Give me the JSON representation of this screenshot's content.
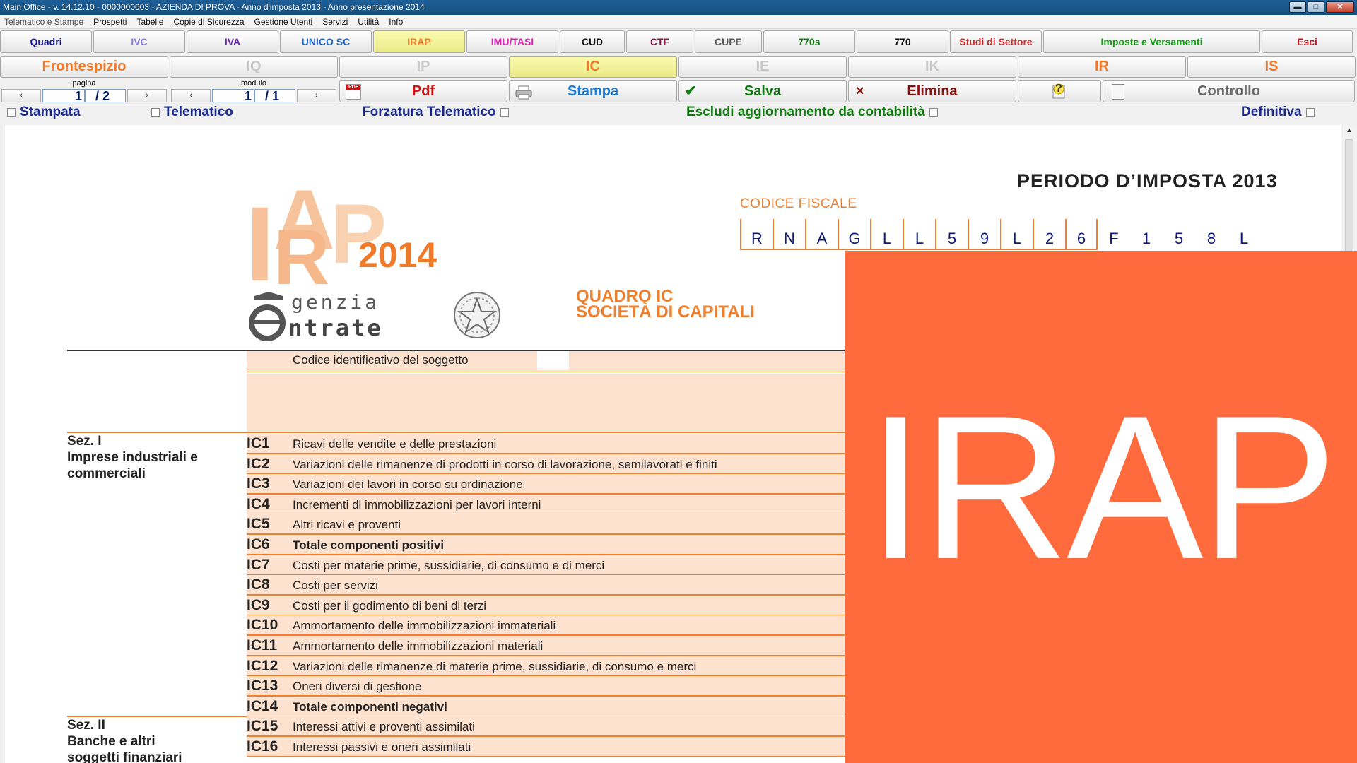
{
  "window": {
    "title": "Main Office - v. 14.12.10 - 0000000003 - AZIENDA DI PROVA - Anno d'imposta 2013 - Anno presentazione 2014",
    "minimize": "▬",
    "maximize": "□",
    "close": "✕"
  },
  "menu": [
    "Telematico e Stampe",
    "Prospetti",
    "Tabelle",
    "Copie di Sicurezza",
    "Gestione Utenti",
    "Servizi",
    "Utilità",
    "Info"
  ],
  "tabs": [
    {
      "label": "Quadri",
      "color": "#1a1aa0"
    },
    {
      "label": "IVC",
      "color": "#8a7ad8"
    },
    {
      "label": "IVA",
      "color": "#6a2ab0"
    },
    {
      "label": "UNICO SC",
      "color": "#1a6ad0"
    },
    {
      "label": "IRAP",
      "color": "#f07a2a"
    },
    {
      "label": "IMU/TASI",
      "color": "#e020b0"
    },
    {
      "label": "CUD",
      "color": "#111111"
    },
    {
      "label": "CTF",
      "color": "#8a1a4a"
    },
    {
      "label": "CUPE",
      "color": "#5a5a5a"
    },
    {
      "label": "770s",
      "color": "#107a10"
    },
    {
      "label": "770",
      "color": "#111111"
    },
    {
      "label": "Studi di Settore",
      "color": "#d02a2a"
    },
    {
      "label": "Imposte e Versamenti",
      "color": "#10a010"
    },
    {
      "label": "Esci",
      "color": "#d01010"
    }
  ],
  "quadri": [
    {
      "label": "Frontespizio",
      "color": "#f07a2a"
    },
    {
      "label": "IQ",
      "color": "#c8c8c8"
    },
    {
      "label": "IP",
      "color": "#c8c8c8"
    },
    {
      "label": "IC",
      "color": "#f07a2a"
    },
    {
      "label": "IE",
      "color": "#c8c8c8"
    },
    {
      "label": "IK",
      "color": "#c8c8c8"
    },
    {
      "label": "IR",
      "color": "#f07a2a"
    },
    {
      "label": "IS",
      "color": "#f07a2a"
    }
  ],
  "pager": {
    "pagina_label": "pagina",
    "pagina_value": "1",
    "pagina_total": "/ 2",
    "modulo_label": "modulo",
    "modulo_value": "1",
    "modulo_total": "/ 1",
    "prev": "‹",
    "next": "›"
  },
  "actions": {
    "pdf": "Pdf",
    "stampa": "Stampa",
    "salva": "Salva",
    "elimina": "Elimina",
    "controllo": "Controllo",
    "pdf_icon_text": "PDF",
    "salva_icon": "✔",
    "elimina_icon": "×",
    "help_icon": "?"
  },
  "checks": {
    "stampata": "Stampata",
    "telematico": "Telematico",
    "forzatura": "Forzatura Telematico",
    "escludi": "Escludi aggiornamento da contabilità",
    "definitiva": "Definitiva"
  },
  "form": {
    "periodo": "PERIODO D’IMPOSTA 2013",
    "codice_fiscale_label": "CODICE FISCALE",
    "codice_fiscale": [
      "R",
      "N",
      "A",
      "G",
      "L",
      "L",
      "5",
      "9",
      "L",
      "2",
      "6",
      "F",
      "1",
      "5",
      "8",
      "L"
    ],
    "logo_irap_letters": "IRAP",
    "logo_year": "2014",
    "logo_agenzia": "genzia",
    "logo_entrate": "ntrate",
    "quadro_line1": "QUADRO IC",
    "quadro_line2": "SOCIETÀ DI CAPITALI",
    "codice_identificativo": "Codice identificativo del soggetto",
    "sez1_line1": "Sez. I",
    "sez1_line2": "Imprese industriali e",
    "sez1_line3": "commerciali",
    "sez2_line1": "Sez. II",
    "sez2_line2": "Banche e altri",
    "sez2_line3": "soggetti finanziari",
    "rows": [
      {
        "code": "IC1",
        "desc": "Ricavi delle vendite e delle prestazioni",
        "bold": false
      },
      {
        "code": "IC2",
        "desc": "Variazioni delle rimanenze di prodotti in corso di lavorazione, semilavorati e finiti",
        "bold": false
      },
      {
        "code": "IC3",
        "desc": "Variazioni dei lavori in corso su ordinazione",
        "bold": false
      },
      {
        "code": "IC4",
        "desc": "Incrementi di immobilizzazioni per lavori interni",
        "bold": false
      },
      {
        "code": "IC5",
        "desc": "Altri ricavi e proventi",
        "bold": false
      },
      {
        "code": "IC6",
        "desc": "Totale componenti positivi",
        "bold": true
      },
      {
        "code": "IC7",
        "desc": "Costi per materie prime, sussidiarie, di consumo e di merci",
        "bold": false
      },
      {
        "code": "IC8",
        "desc": "Costi per servizi",
        "bold": false
      },
      {
        "code": "IC9",
        "desc": "Costi per il godimento di beni di terzi",
        "bold": false
      },
      {
        "code": "IC10",
        "desc": "Ammortamento delle immobilizzazioni immateriali",
        "bold": false
      },
      {
        "code": "IC11",
        "desc": "Ammortamento delle immobilizzazioni materiali",
        "bold": false
      },
      {
        "code": "IC12",
        "desc": "Variazioni delle rimanenze di materie prime, sussidiarie, di consumo e merci",
        "bold": false
      },
      {
        "code": "IC13",
        "desc": "Oneri diversi di gestione",
        "bold": false
      },
      {
        "code": "IC14",
        "desc": "Totale componenti negativi",
        "bold": true
      },
      {
        "code": "IC15",
        "desc": "Interessi attivi e proventi assimilati",
        "bold": false
      },
      {
        "code": "IC16",
        "desc": "Interessi passivi e oneri assimilati",
        "bold": false
      }
    ]
  },
  "overlay": {
    "text": "IRAP",
    "color": "#ff6b3d"
  }
}
